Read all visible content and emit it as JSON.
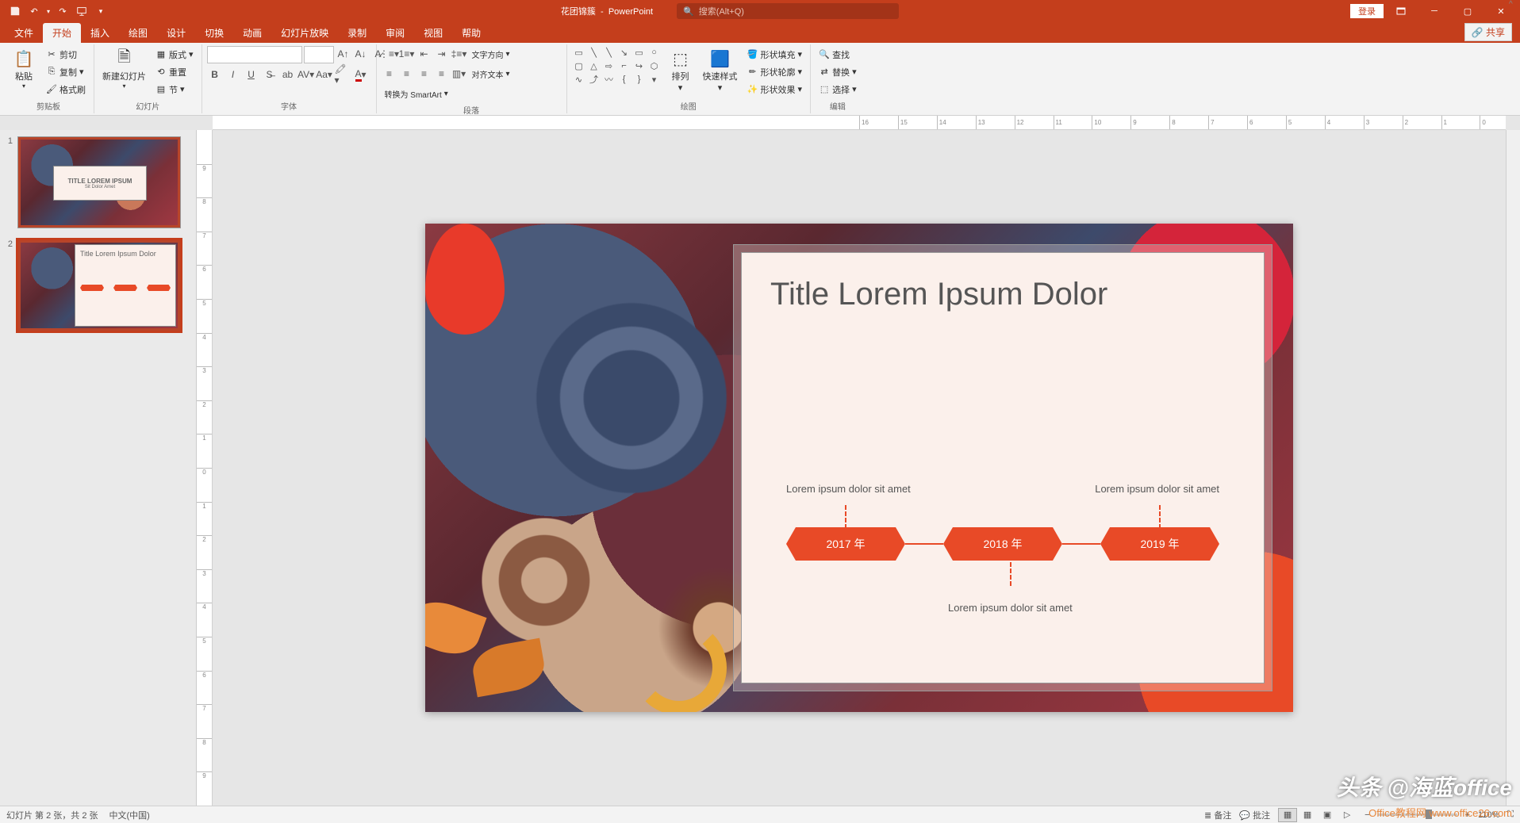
{
  "titlebar": {
    "doc_name": "花团锦簇",
    "app_name": "PowerPoint",
    "search_placeholder": "搜索(Alt+Q)",
    "login": "登录"
  },
  "tabs": {
    "file": "文件",
    "home": "开始",
    "insert": "插入",
    "draw": "绘图",
    "design": "设计",
    "transitions": "切换",
    "animations": "动画",
    "slideshow": "幻灯片放映",
    "record": "录制",
    "review": "审阅",
    "view": "视图",
    "help": "帮助",
    "share": "共享"
  },
  "ribbon": {
    "clipboard": {
      "paste": "粘贴",
      "cut": "剪切",
      "copy": "复制",
      "format_painter": "格式刷",
      "label": "剪贴板"
    },
    "slides": {
      "new_slide": "新建幻灯片",
      "layout": "版式",
      "reset": "重置",
      "section": "节",
      "label": "幻灯片"
    },
    "font": {
      "label": "字体"
    },
    "paragraph": {
      "text_dir": "文字方向",
      "align_text": "对齐文本",
      "smartart": "转换为 SmartArt",
      "label": "段落"
    },
    "drawing": {
      "arrange": "排列",
      "quick_styles": "快速样式",
      "shape_fill": "形状填充",
      "shape_outline": "形状轮廓",
      "shape_effects": "形状效果",
      "label": "绘图"
    },
    "editing": {
      "find": "查找",
      "replace": "替换",
      "select": "选择",
      "label": "编辑"
    }
  },
  "slide_content": {
    "title": "Title Lorem Ipsum Dolor",
    "caption1": "Lorem ipsum dolor sit amet",
    "caption2": "Lorem ipsum dolor sit amet",
    "caption3": "Lorem ipsum dolor sit amet",
    "year1": "2017 年",
    "year2": "2018 年",
    "year3": "2019 年"
  },
  "thumbs": {
    "t1_title": "TITLE LOREM IPSUM",
    "t1_sub": "Sit Dolor Amet",
    "t2_title": "Title Lorem Ipsum Dolor"
  },
  "status": {
    "slide_info": "幻灯片 第 2 张，共 2 张",
    "language": "中文(中国)",
    "notes": "备注",
    "comments": "批注",
    "zoom": "110%"
  },
  "watermark": {
    "main": "头条 @海蓝office",
    "sub": "Office教程网 www.office26.com"
  }
}
